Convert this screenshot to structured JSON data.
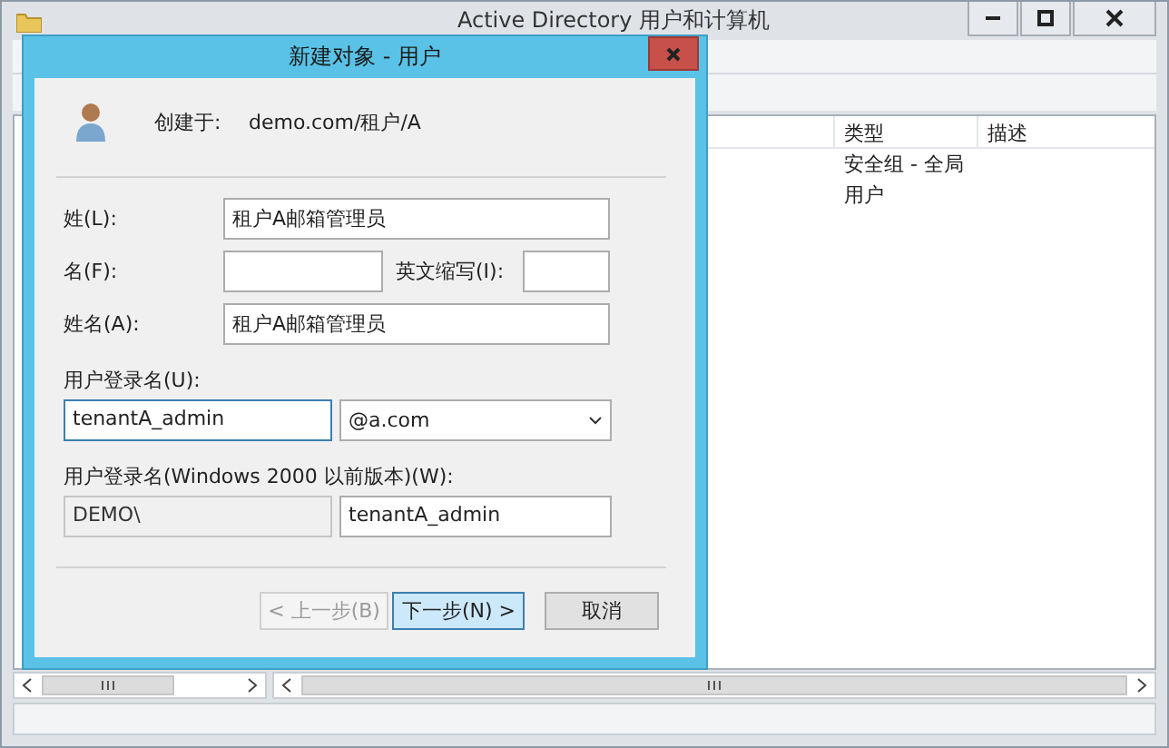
{
  "window": {
    "title": "Active Directory 用户和计算机"
  },
  "list": {
    "columns": [
      {
        "label": "类型"
      },
      {
        "label": "描述"
      }
    ],
    "rows": [
      {
        "type": "安全组 - 全局"
      },
      {
        "type": "用户"
      }
    ]
  },
  "dialog": {
    "title": "新建对象 - 用户",
    "created_in_label": "创建于:",
    "created_in": "demo.com/租户/A",
    "surname": {
      "label": "姓(L):",
      "value": "租户A邮箱管理员"
    },
    "given_name": {
      "label": "名(F):"
    },
    "initials": {
      "label": "英文缩写(I):"
    },
    "full_name": {
      "label": "姓名(A):",
      "value": "租户A邮箱管理员"
    },
    "logon": {
      "label": "用户登录名(U):",
      "value": "tenantA_admin",
      "focused": true,
      "domain": "@a.com"
    },
    "legacy": {
      "label": "用户登录名(Windows 2000 以前版本)(W):",
      "domain": {
        "value": "DEMO\\",
        "disabled": true
      },
      "value": "tenantA_admin"
    },
    "buttons": [
      {
        "label": "< 上一步(B)",
        "disabled": true,
        "default": false
      },
      {
        "label": "下一步(N) >",
        "disabled": false,
        "default": true
      },
      {
        "label": "取消",
        "disabled": false,
        "default": false
      }
    ]
  }
}
